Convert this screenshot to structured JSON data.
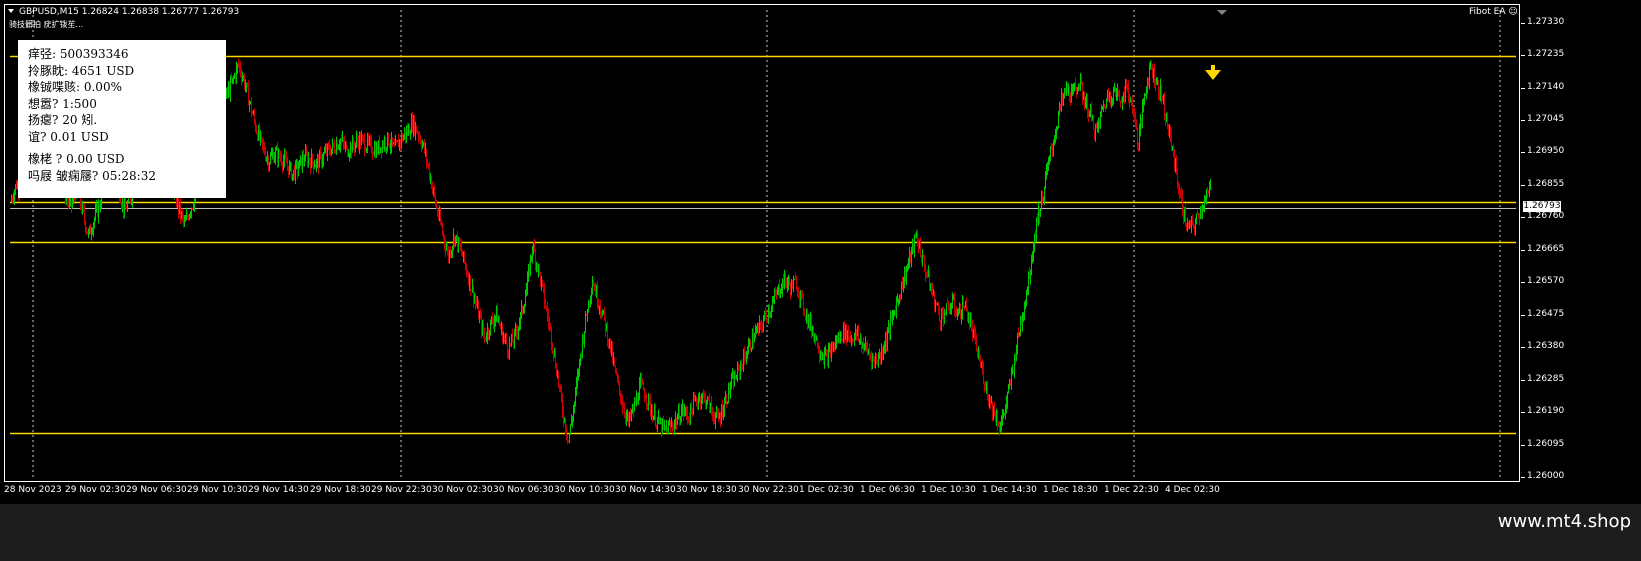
{
  "header": {
    "symbol_line": "GBPUSD,M15  1.26824 1.26838 1.26777 1.26793",
    "subtitle": "骑技髒拍 疣扩䥽苼...",
    "ea_label": "Fibot EA ☺"
  },
  "info_panel": {
    "line1": "痒弪: 500393346",
    "line2": "拎豚眈: 4651 USD",
    "line3": "橡铖喋赅: 0.00%",
    "line4": "想嚣? 1:500",
    "line5": "扬瘪? 20 矧.",
    "line6": "谊? 0.01 USD",
    "line7": "橡栳    ? 0.00 USD",
    "line8": "吗屐     皱痫屦? 05:28:32"
  },
  "current_price": "1.26793",
  "footer": {
    "site": "www.mt4.shop"
  },
  "colors": {
    "bull": "#00c800",
    "bear": "#c80000",
    "level": "#ffd700",
    "arrow": "#ffd700",
    "grid": "#ffffff",
    "background": "#000000"
  },
  "icons": {
    "signal": "down-arrow-icon",
    "ea": "smiley-icon",
    "collapse": "triangle-down-icon"
  },
  "chart_data": {
    "type": "candlestick",
    "symbol": "GBPUSD",
    "timeframe": "M15",
    "y_ticks": [
      "1.27330",
      "1.27235",
      "1.27140",
      "1.27045",
      "1.26950",
      "1.26855",
      "1.26760",
      "1.26665",
      "1.26570",
      "1.26475",
      "1.26380",
      "1.26285",
      "1.26190",
      "1.26095",
      "1.26000"
    ],
    "ylim": [
      1.26,
      1.2737
    ],
    "x_ticks": [
      "28 Nov 2023",
      "29 Nov 02:30",
      "29 Nov 06:30",
      "29 Nov 10:30",
      "29 Nov 14:30",
      "29 Nov 18:30",
      "29 Nov 22:30",
      "30 Nov 02:30",
      "30 Nov 06:30",
      "30 Nov 10:30",
      "30 Nov 14:30",
      "30 Nov 18:30",
      "30 Nov 22:30",
      "1 Dec 02:30",
      "1 Dec 06:30",
      "1 Dec 10:30",
      "1 Dec 14:30",
      "1 Dec 18:30",
      "1 Dec 22:30",
      "4 Dec 02:30"
    ],
    "levels": [
      1.27235,
      1.26809,
      1.26791,
      1.26692,
      1.26132
    ],
    "path": [
      1.2681,
      1.2686,
      1.2684,
      1.2692,
      1.2688,
      1.2696,
      1.2702,
      1.2694,
      1.2689,
      1.2684,
      1.2679,
      1.2685,
      1.2678,
      1.2671,
      1.2676,
      1.2681,
      1.2688,
      1.2691,
      1.2685,
      1.2678,
      1.2682,
      1.2689,
      1.2694,
      1.2698,
      1.2701,
      1.2697,
      1.2693,
      1.2686,
      1.2679,
      1.2674,
      1.2679,
      1.2683,
      1.2691,
      1.2697,
      1.2702,
      1.2706,
      1.2712,
      1.2716,
      1.2721,
      1.2716,
      1.2709,
      1.2702,
      1.2697,
      1.2693,
      1.2695,
      1.2694,
      1.2692,
      1.2689,
      1.2691,
      1.2694,
      1.2693,
      1.2692,
      1.2694,
      1.2696,
      1.2697,
      1.2699,
      1.2696,
      1.2697,
      1.2699,
      1.2698,
      1.2697,
      1.2696,
      1.2698,
      1.2699,
      1.2696,
      1.2699,
      1.2701,
      1.2704,
      1.2701,
      1.2696,
      1.2688,
      1.2679,
      1.2672,
      1.2665,
      1.2671,
      1.2667,
      1.2661,
      1.2655,
      1.2648,
      1.2641,
      1.2645,
      1.2648,
      1.2642,
      1.2638,
      1.2641,
      1.2647,
      1.2655,
      1.2668,
      1.2661,
      1.2652,
      1.2643,
      1.2632,
      1.262,
      1.2611,
      1.2622,
      1.2636,
      1.2648,
      1.2658,
      1.2652,
      1.2646,
      1.2638,
      1.2629,
      1.2622,
      1.2616,
      1.2621,
      1.2627,
      1.2624,
      1.2619,
      1.2616,
      1.2614,
      1.2615,
      1.2617,
      1.262,
      1.2618,
      1.2622,
      1.2624,
      1.2623,
      1.2619,
      1.2617,
      1.2622,
      1.2627,
      1.263,
      1.2634,
      1.2638,
      1.2642,
      1.2644,
      1.2648,
      1.2651,
      1.2655,
      1.2658,
      1.2656,
      1.2657,
      1.2651,
      1.2646,
      1.2642,
      1.2637,
      1.2635,
      1.2638,
      1.2641,
      1.2643,
      1.2641,
      1.2642,
      1.2639,
      1.2637,
      1.2634,
      1.2636,
      1.2641,
      1.2647,
      1.2653,
      1.2659,
      1.2665,
      1.2671,
      1.2664,
      1.2658,
      1.2652,
      1.2647,
      1.2649,
      1.2651,
      1.2648,
      1.2651,
      1.2645,
      1.2638,
      1.2631,
      1.2624,
      1.2619,
      1.2615,
      1.2622,
      1.2631,
      1.2642,
      1.2651,
      1.2662,
      1.2675,
      1.2682,
      1.2692,
      1.27,
      1.2709,
      1.2714,
      1.2712,
      1.2716,
      1.2711,
      1.2706,
      1.2701,
      1.2708,
      1.2712,
      1.2713,
      1.2711,
      1.2714,
      1.2709,
      1.2698,
      1.2712,
      1.2721,
      1.2716,
      1.2711,
      1.2702,
      1.2693,
      1.2682,
      1.2674,
      1.2673,
      1.2677,
      1.2681,
      1.2684,
      1.2685,
      1.2679
    ]
  }
}
